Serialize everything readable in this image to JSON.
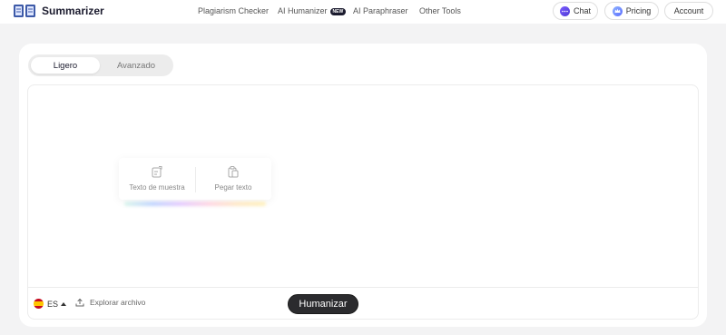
{
  "brand": {
    "name": "Summarizer",
    "icon": "book-logo-icon"
  },
  "nav": {
    "items": [
      {
        "label": "Plagiarism Checker"
      },
      {
        "label": "AI Humanizer",
        "badge": "NEW"
      },
      {
        "label": "AI Paraphraser"
      },
      {
        "label": "Other Tools"
      }
    ]
  },
  "header_buttons": {
    "chat": {
      "label": "Chat",
      "icon": "chat-bubble-icon"
    },
    "pricing": {
      "label": "Pricing",
      "icon": "crown-icon"
    },
    "account": {
      "label": "Account"
    }
  },
  "mode_tabs": [
    {
      "label": "Ligero",
      "active": true
    },
    {
      "label": "Avanzado",
      "active": false
    }
  ],
  "editor": {
    "value": "",
    "actions": {
      "sample": {
        "label": "Texto de muestra",
        "icon": "sample-text-icon"
      },
      "paste": {
        "label": "Pegar texto",
        "icon": "clipboard-icon"
      }
    }
  },
  "footer": {
    "language": {
      "code": "ES",
      "icon": "spain-flag-icon"
    },
    "upload": {
      "label": "Explorar archivo",
      "icon": "upload-icon"
    },
    "submit_label": "Humanizar"
  },
  "colors": {
    "primary_button": "#2b2b2e",
    "chat_accent": "#6a4ef0",
    "pricing_accent": "#6f8bff",
    "background": "#f3f3f4"
  }
}
